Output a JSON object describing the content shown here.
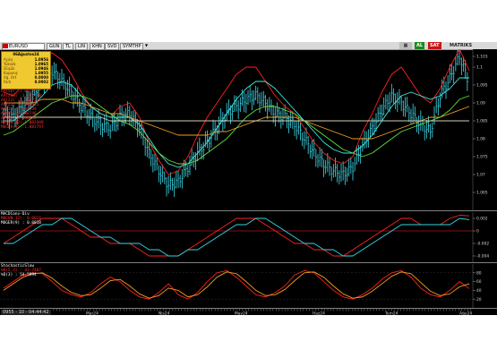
{
  "toolbar": {
    "symbol": "EURUSD",
    "buttons": [
      "GUN",
      "TL",
      "LIN",
      "KHN",
      "SVD",
      "SYMTHP"
    ],
    "badges": [
      {
        "label": "AL",
        "color": "#1a8a1a"
      },
      {
        "label": "SAT",
        "color": "#c81414"
      }
    ],
    "brand": "MATRIKS"
  },
  "info_box": {
    "title": "06Ağustos24",
    "rows": [
      {
        "label": "Açılış",
        "value": "1.0956"
      },
      {
        "label": "Yüksek",
        "value": "1.0965"
      },
      {
        "label": "Düşük",
        "value": "1.0946"
      },
      {
        "label": "Kapanış",
        "value": "1.0955"
      },
      {
        "label": "Ağ. Ort",
        "value": "0.0000"
      },
      {
        "label": "Fark",
        "value": "0.0002"
      }
    ]
  },
  "legends": {
    "main": [
      {
        "text": "AV(56)   :1.081867",
        "color": "#ff3030"
      },
      {
        "text": "AV(200)  :1.081748",
        "color": "#ff3030"
      },
      {
        "text": "AV(22)   :1.088735",
        "color": "#ff3030"
      },
      {
        "text": "AV(22)   :1.086905",
        "color": "#ff3030"
      },
      {
        "text": "AV(3)    :1.088739",
        "color": "#ff3030"
      },
      {
        "text": "AV(8)    :1.088746",
        "color": "#ff3030"
      },
      {
        "text": "AV(8)    :1.088734",
        "color": "#ff3030"
      },
      {
        "text": "MOCUN,12):1.002448",
        "color": "#ff3030"
      },
      {
        "text": "MOGER(9) :1.081797",
        "color": "#ff3030"
      }
    ],
    "macd_title": "MACDConv-Div",
    "macd": [
      {
        "text": "MOCUN,12): 0.0024",
        "color": "#ff3030"
      },
      {
        "text": "MOGER(9) : 0.0018",
        "color": "#ffffff"
      }
    ],
    "stoch_title": "StochasticSlow",
    "stoch": [
      {
        "text": "%K(5,3)  : 43.7487",
        "color": "#ff3030"
      },
      {
        "text": "%D(3)    : 54.5994",
        "color": "#ffffff"
      }
    ]
  },
  "status_time": "0955 - 10 - 04:44:42",
  "chart_data": [
    {
      "type": "line",
      "panel": "price",
      "y_ticks": [
        "1.103",
        "1.1",
        "1.095",
        "1.09",
        "1.085",
        "1.08",
        "1.075",
        "1.07",
        "1.065"
      ],
      "ylim": [
        1.06,
        1.105
      ],
      "x_tick_labels": [
        "Mar24",
        "Nis24",
        "May24",
        "Haz24",
        "Tem24",
        "Ağu24"
      ],
      "series": [
        {
          "name": "price",
          "color": "#40e0f0",
          "values": [
            1.087,
            1.086,
            1.089,
            1.092,
            1.096,
            1.099,
            1.096,
            1.093,
            1.089,
            1.086,
            1.084,
            1.083,
            1.086,
            1.087,
            1.083,
            1.076,
            1.071,
            1.067,
            1.068,
            1.072,
            1.076,
            1.079,
            1.083,
            1.087,
            1.089,
            1.091,
            1.092,
            1.09,
            1.087,
            1.086,
            1.084,
            1.08,
            1.076,
            1.073,
            1.071,
            1.07,
            1.072,
            1.078,
            1.083,
            1.088,
            1.092,
            1.09,
            1.087,
            1.084,
            1.082,
            1.092,
            1.097,
            1.103,
            1.0955
          ]
        },
        {
          "name": "upper",
          "color": "#ff2020",
          "values": [
            1.093,
            1.092,
            1.095,
            1.099,
            1.102,
            1.104,
            1.102,
            1.098,
            1.093,
            1.089,
            1.087,
            1.086,
            1.089,
            1.09,
            1.086,
            1.079,
            1.074,
            1.07,
            1.071,
            1.075,
            1.081,
            1.086,
            1.09,
            1.094,
            1.098,
            1.1,
            1.1,
            1.096,
            1.092,
            1.089,
            1.087,
            1.083,
            1.079,
            1.076,
            1.074,
            1.073,
            1.075,
            1.082,
            1.087,
            1.093,
            1.098,
            1.1,
            1.096,
            1.092,
            1.09,
            1.094,
            1.1,
            1.105,
            1.099
          ]
        },
        {
          "name": "mid",
          "color": "#40f0e0",
          "values": [
            1.085,
            1.085,
            1.087,
            1.089,
            1.092,
            1.095,
            1.096,
            1.095,
            1.092,
            1.089,
            1.087,
            1.086,
            1.086,
            1.086,
            1.084,
            1.08,
            1.076,
            1.073,
            1.072,
            1.073,
            1.076,
            1.079,
            1.083,
            1.087,
            1.091,
            1.094,
            1.096,
            1.096,
            1.094,
            1.091,
            1.088,
            1.085,
            1.082,
            1.079,
            1.077,
            1.076,
            1.076,
            1.078,
            1.081,
            1.085,
            1.089,
            1.092,
            1.093,
            1.092,
            1.091,
            1.092,
            1.094,
            1.097,
            1.097
          ]
        },
        {
          "name": "slow",
          "color": "#f0a020",
          "values": [
            1.09,
            1.09,
            1.09,
            1.09,
            1.091,
            1.091,
            1.091,
            1.09,
            1.09,
            1.089,
            1.088,
            1.087,
            1.087,
            1.086,
            1.085,
            1.084,
            1.083,
            1.082,
            1.081,
            1.081,
            1.081,
            1.081,
            1.082,
            1.082,
            1.083,
            1.084,
            1.085,
            1.086,
            1.086,
            1.086,
            1.086,
            1.085,
            1.084,
            1.083,
            1.082,
            1.081,
            1.08,
            1.08,
            1.08,
            1.081,
            1.082,
            1.083,
            1.084,
            1.085,
            1.086,
            1.086,
            1.087,
            1.088,
            1.089
          ]
        },
        {
          "name": "green",
          "color": "#60e040",
          "values": [
            1.081,
            1.082,
            1.084,
            1.086,
            1.088,
            1.09,
            1.091,
            1.092,
            1.092,
            1.091,
            1.089,
            1.087,
            1.085,
            1.084,
            1.082,
            1.079,
            1.076,
            1.074,
            1.073,
            1.073,
            1.074,
            1.076,
            1.078,
            1.08,
            1.083,
            1.086,
            1.088,
            1.089,
            1.089,
            1.088,
            1.087,
            1.085,
            1.083,
            1.081,
            1.079,
            1.077,
            1.076,
            1.075,
            1.076,
            1.078,
            1.08,
            1.082,
            1.083,
            1.084,
            1.085,
            1.086,
            1.088,
            1.091,
            1.092
          ]
        },
        {
          "name": "flat",
          "color": "#d0d0b0",
          "values": [
            1.086,
            1.086,
            1.086,
            1.086,
            1.086,
            1.086,
            1.086,
            1.086,
            1.086,
            1.086,
            1.086,
            1.085,
            1.085,
            1.085,
            1.085,
            1.085,
            1.085,
            1.085,
            1.085,
            1.085,
            1.085,
            1.085,
            1.085,
            1.085,
            1.085,
            1.085,
            1.085,
            1.085,
            1.085,
            1.085,
            1.085,
            1.085,
            1.085,
            1.085,
            1.085,
            1.085,
            1.085,
            1.085,
            1.085,
            1.085,
            1.085,
            1.085,
            1.085,
            1.085,
            1.085,
            1.085,
            1.085,
            1.085,
            1.085
          ]
        }
      ]
    },
    {
      "type": "line",
      "panel": "macd",
      "y_ticks": [
        "0.002",
        "0",
        "-0.002",
        "-0.004"
      ],
      "ylim": [
        -0.005,
        0.003
      ],
      "series": [
        {
          "name": "MOCUN,12)",
          "color": "#ff2020",
          "values": [
            -0.002,
            -0.001,
            0.0,
            0.001,
            0.002,
            0.002,
            0.002,
            0.001,
            0.0,
            -0.001,
            -0.001,
            -0.002,
            -0.002,
            -0.002,
            -0.003,
            -0.004,
            -0.004,
            -0.004,
            -0.004,
            -0.003,
            -0.002,
            -0.001,
            0.0,
            0.001,
            0.002,
            0.002,
            0.002,
            0.001,
            0.0,
            -0.001,
            -0.002,
            -0.002,
            -0.003,
            -0.003,
            -0.004,
            -0.004,
            -0.003,
            -0.002,
            -0.001,
            0.0,
            0.001,
            0.002,
            0.002,
            0.001,
            0.001,
            0.001,
            0.002,
            0.0025,
            0.0024
          ]
        },
        {
          "name": "MOGER(9)",
          "color": "#30d8e8",
          "values": [
            -0.002,
            -0.002,
            -0.001,
            0.0,
            0.001,
            0.001,
            0.002,
            0.002,
            0.001,
            0.0,
            -0.001,
            -0.001,
            -0.002,
            -0.002,
            -0.002,
            -0.003,
            -0.003,
            -0.004,
            -0.004,
            -0.003,
            -0.003,
            -0.002,
            -0.001,
            0.0,
            0.001,
            0.001,
            0.002,
            0.002,
            0.001,
            0.0,
            -0.001,
            -0.002,
            -0.002,
            -0.003,
            -0.003,
            -0.004,
            -0.004,
            -0.003,
            -0.002,
            -0.001,
            0.0,
            0.001,
            0.001,
            0.001,
            0.001,
            0.001,
            0.001,
            0.002,
            0.0018
          ]
        }
      ]
    },
    {
      "type": "line",
      "panel": "stochastic",
      "y_ticks": [
        "80",
        "60",
        "40",
        "20"
      ],
      "ylim": [
        0,
        100
      ],
      "series": [
        {
          "name": "%K(5,3)",
          "color": "#ff2020",
          "values": [
            45,
            60,
            75,
            80,
            78,
            60,
            40,
            30,
            25,
            35,
            55,
            70,
            60,
            40,
            25,
            20,
            35,
            55,
            30,
            20,
            35,
            60,
            80,
            85,
            70,
            50,
            30,
            25,
            35,
            50,
            75,
            85,
            80,
            60,
            40,
            25,
            20,
            30,
            45,
            65,
            80,
            85,
            70,
            45,
            30,
            25,
            40,
            60,
            44
          ]
        },
        {
          "name": "%D(3)",
          "color": "#f0a020",
          "values": [
            40,
            55,
            70,
            78,
            80,
            68,
            50,
            35,
            28,
            30,
            45,
            62,
            65,
            50,
            32,
            22,
            28,
            45,
            40,
            25,
            30,
            48,
            70,
            82,
            78,
            60,
            40,
            28,
            30,
            42,
            62,
            80,
            82,
            70,
            50,
            32,
            22,
            25,
            38,
            55,
            72,
            82,
            78,
            58,
            38,
            28,
            32,
            48,
            55
          ]
        }
      ]
    }
  ]
}
